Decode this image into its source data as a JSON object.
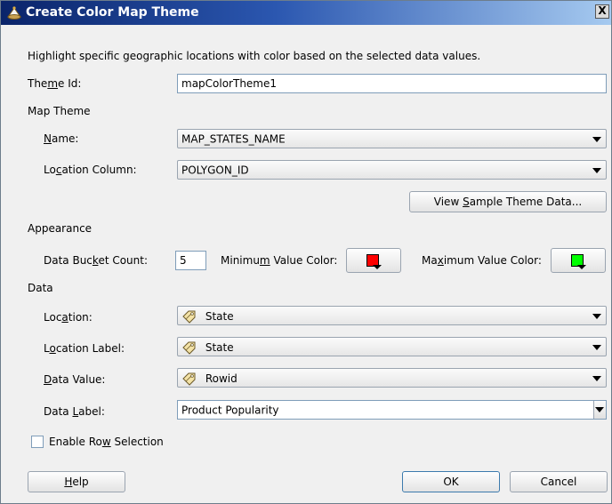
{
  "window": {
    "title": "Create Color Map Theme",
    "close_glyph": "X"
  },
  "description": "Highlight specific geographic locations with color based on the selected data values.",
  "theme_id": {
    "label_pre": "The",
    "label_u": "m",
    "label_post": "e Id:",
    "value": "mapColorTheme1"
  },
  "map_theme": {
    "section": "Map Theme",
    "name": {
      "label_pre": "",
      "label_u": "N",
      "label_post": "ame:",
      "value": "MAP_STATES_NAME"
    },
    "location_column": {
      "label_pre": "Lo",
      "label_u": "c",
      "label_post": "ation Column:",
      "value": "POLYGON_ID"
    },
    "view_sample_button": {
      "pre": "View ",
      "u": "S",
      "post": "ample Theme Data..."
    }
  },
  "appearance": {
    "section": "Appearance",
    "bucket_count": {
      "label_pre": "Data Buc",
      "label_u": "k",
      "label_post": "et Count:",
      "value": "5"
    },
    "min_color": {
      "label_pre": "Minimu",
      "label_u": "m",
      "label_post": " Value Color:",
      "color": "#ff0000"
    },
    "max_color": {
      "label_pre": "Ma",
      "label_u": "x",
      "label_post": "imum Value Color:",
      "color": "#00ff00"
    }
  },
  "data": {
    "section": "Data",
    "location": {
      "label_pre": "Loc",
      "label_u": "a",
      "label_post": "tion:",
      "value": "State",
      "icon": "tag-icon"
    },
    "location_label": {
      "label_pre": "L",
      "label_u": "o",
      "label_post": "cation Label:",
      "value": "State",
      "icon": "tag-icon"
    },
    "data_value": {
      "label_pre": "",
      "label_u": "D",
      "label_post": "ata Value:",
      "value": "Rowid",
      "icon": "tag-icon"
    },
    "data_label": {
      "label_pre": "Data ",
      "label_u": "L",
      "label_post": "abel:",
      "value": "Product Popularity"
    }
  },
  "enable_row_selection": {
    "pre": "Enable Ro",
    "u": "w",
    "post": " Selection",
    "checked": false
  },
  "buttons": {
    "help": {
      "pre": "",
      "u": "H",
      "post": "elp"
    },
    "ok": "OK",
    "cancel": "Cancel"
  }
}
